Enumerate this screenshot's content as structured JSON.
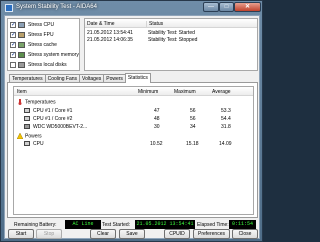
{
  "window": {
    "title": "System Stability Test - AIDA64",
    "controls": {
      "minimize": "—",
      "maximize": "□",
      "close": "✕"
    }
  },
  "stress_options": [
    {
      "label": "Stress CPU",
      "checked": true
    },
    {
      "label": "Stress FPU",
      "checked": true
    },
    {
      "label": "Stress cache",
      "checked": true
    },
    {
      "label": "Stress system memory",
      "checked": true
    },
    {
      "label": "Stress local disks",
      "checked": false
    }
  ],
  "log": {
    "headers": {
      "datetime": "Date & Time",
      "status": "Status"
    },
    "rows": [
      {
        "datetime": "21.05.2012 13:54:41",
        "status": "Stability Test: Started"
      },
      {
        "datetime": "21.05.2012 14:06:35",
        "status": "Stability Test: Stopped"
      }
    ]
  },
  "tabs": [
    "Temperatures",
    "Cooling Fans",
    "Voltages",
    "Powers",
    "Statistics"
  ],
  "active_tab": "Statistics",
  "statistics": {
    "headers": {
      "item": "Item",
      "minimum": "Minimum",
      "maximum": "Maximum",
      "average": "Average"
    },
    "groups": [
      {
        "name": "Temperatures",
        "rows": [
          {
            "item": "CPU #1 / Core #1",
            "minimum": "47",
            "maximum": "56",
            "average": "53.3"
          },
          {
            "item": "CPU #1 / Core #2",
            "minimum": "48",
            "maximum": "56",
            "average": "54.4"
          },
          {
            "item": "WDC WD5000BEVT-2...",
            "minimum": "30",
            "maximum": "34",
            "average": "31.8"
          }
        ]
      },
      {
        "name": "Powers",
        "rows": [
          {
            "item": "CPU",
            "minimum": "10.52",
            "maximum": "15.18",
            "average": "14.09"
          }
        ]
      }
    ]
  },
  "status": {
    "battery_label": "Remaining Battery:",
    "battery_value": "AC Line",
    "started_label": "Test Started:",
    "started_value": "21.05.2012 13:54:41",
    "elapsed_label": "Elapsed Time:",
    "elapsed_value": "0:11:54"
  },
  "buttons": {
    "start": "Start",
    "stop": "Stop",
    "clear": "Clear",
    "save": "Save",
    "cpuid": "CPUID",
    "preferences": "Preferences",
    "close": "Close"
  },
  "colors": {
    "status_text": "#3cff3c",
    "status_bg": "#000000",
    "title_text": "#ffffff"
  }
}
